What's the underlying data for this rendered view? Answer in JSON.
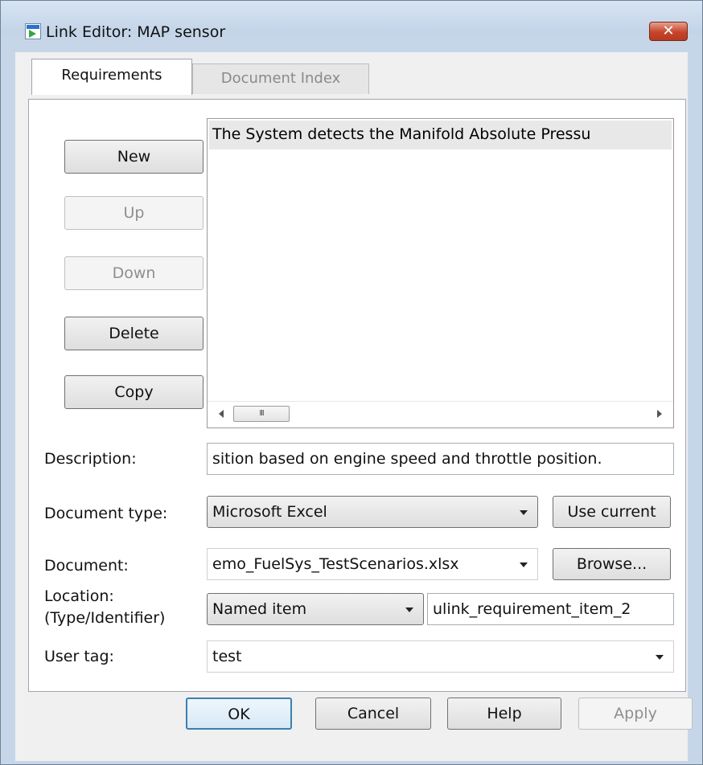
{
  "window": {
    "title": "Link Editor: MAP sensor",
    "close_glyph": "✕"
  },
  "tabs": [
    {
      "label": "Requirements",
      "active": true
    },
    {
      "label": "Document Index",
      "active": false
    }
  ],
  "side_buttons": {
    "new": "New",
    "up": "Up",
    "down": "Down",
    "delete": "Delete",
    "copy": "Copy"
  },
  "requirements_list": {
    "items": [
      "The System detects the Manifold Absolute Pressu"
    ],
    "scroll_thumb_glyph": "III"
  },
  "form": {
    "description_label": "Description:",
    "description_value": "sition based on engine speed and throttle position.",
    "doc_type_label": "Document type:",
    "doc_type_value": "Microsoft Excel",
    "use_current_label": "Use current",
    "document_label": "Document:",
    "document_value": "emo_FuelSys_TestScenarios.xlsx",
    "browse_label": "Browse...",
    "location_label_1": "Location:",
    "location_label_2": "(Type/Identifier)",
    "location_type_value": "Named item",
    "location_id_value": "ulink_requirement_item_2",
    "user_tag_label": "User tag:",
    "user_tag_value": "test"
  },
  "footer": {
    "ok": "OK",
    "cancel": "Cancel",
    "help": "Help",
    "apply": "Apply"
  },
  "icons": {
    "app": "simulink-app-icon",
    "close": "close-icon",
    "dropdown": "chevron-down-icon"
  },
  "colors": {
    "title_bar": "#c6d6e8",
    "close_button": "#c8442b",
    "default_button_border": "#3c7fb1"
  }
}
